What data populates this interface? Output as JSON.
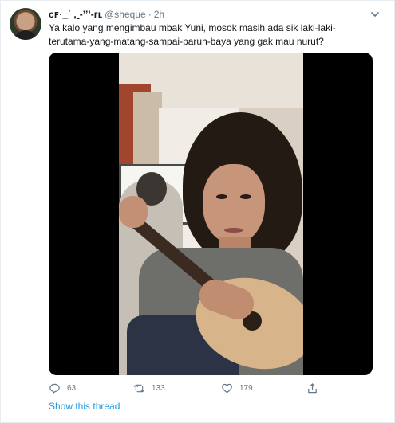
{
  "tweet": {
    "display_name": "ᴄꜰ·   ̲ ˙ ,ˍ‑ʼʼʼ‑ᴦʟ",
    "handle": "@sheque",
    "separator": "·",
    "time": "2h",
    "text": "Ya kalo yang mengimbau mbak Yuni, mosok masih ada sik laki-laki-terutama-yang-matang-sampai-paruh-baya yang gak mau nurut?",
    "avatar_icon": "user-avatar",
    "media_type": "video"
  },
  "actions": {
    "reply_count": "63",
    "retweet_count": "133",
    "like_count": "179",
    "reply_icon": "reply-icon",
    "retweet_icon": "retweet-icon",
    "like_icon": "heart-icon",
    "share_icon": "share-icon"
  },
  "show_thread_label": "Show this thread",
  "colors": {
    "link": "#1b95e0",
    "secondary_text": "#657786",
    "primary_text": "#14171a"
  }
}
